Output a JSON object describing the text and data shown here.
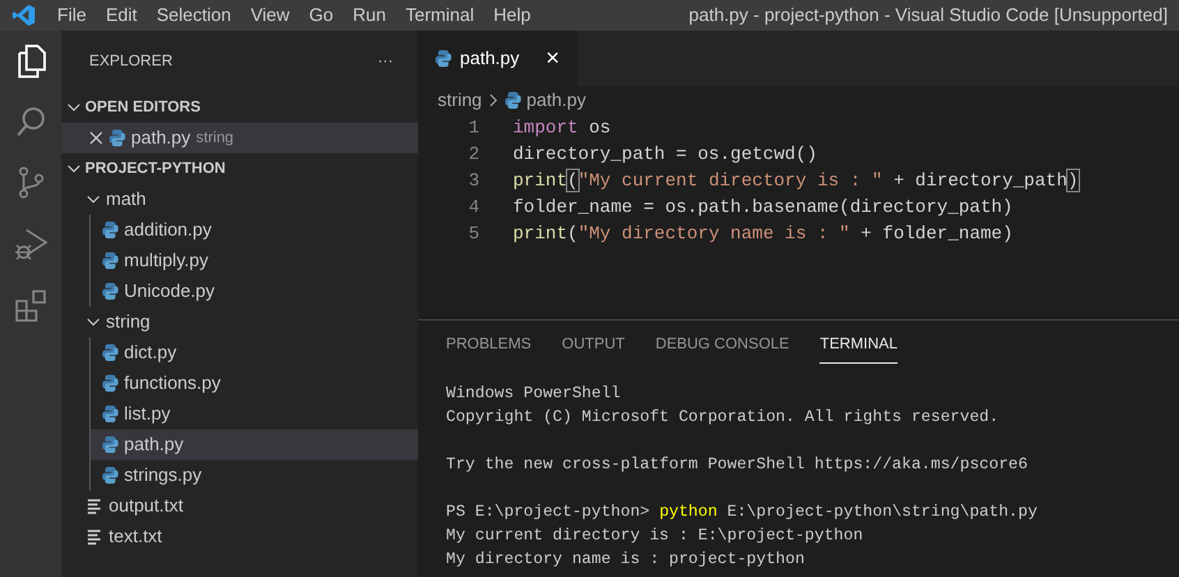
{
  "window": {
    "title": "path.py - project-python - Visual Studio Code [Unsupported]"
  },
  "menu": [
    "File",
    "Edit",
    "Selection",
    "View",
    "Go",
    "Run",
    "Terminal",
    "Help"
  ],
  "activity_bar": [
    {
      "kind": "files",
      "selected": true
    },
    {
      "kind": "search",
      "selected": false
    },
    {
      "kind": "source-control",
      "selected": false
    },
    {
      "kind": "run",
      "selected": false
    },
    {
      "kind": "extensions",
      "selected": false
    }
  ],
  "sidebar": {
    "title": "EXPLORER",
    "more": "···",
    "open_editors": {
      "label": "OPEN EDITORS",
      "expanded": true,
      "items": [
        {
          "name": "path.py",
          "folder": "string",
          "kind": "python",
          "selected": true
        }
      ]
    },
    "project": {
      "label": "PROJECT-PYTHON",
      "expanded": true,
      "children": [
        {
          "name": "math",
          "kind": "folder",
          "expanded": true,
          "selected": false,
          "children": [
            {
              "name": "addition.py",
              "kind": "python",
              "selected": false
            },
            {
              "name": "multiply.py",
              "kind": "python",
              "selected": false
            },
            {
              "name": "Unicode.py",
              "kind": "python",
              "selected": false
            }
          ]
        },
        {
          "name": "string",
          "kind": "folder",
          "expanded": true,
          "selected": false,
          "children": [
            {
              "name": "dict.py",
              "kind": "python",
              "selected": false
            },
            {
              "name": "functions.py",
              "kind": "python",
              "selected": false
            },
            {
              "name": "list.py",
              "kind": "python",
              "selected": false
            },
            {
              "name": "path.py",
              "kind": "python",
              "selected": true
            },
            {
              "name": "strings.py",
              "kind": "python",
              "selected": false
            }
          ]
        },
        {
          "name": "output.txt",
          "kind": "text",
          "selected": false
        },
        {
          "name": "text.txt",
          "kind": "text",
          "selected": false
        }
      ]
    }
  },
  "editor": {
    "tabs": [
      {
        "label": "path.py",
        "close": "×",
        "selected": true
      }
    ],
    "breadcrumb": [
      "string",
      "path.py"
    ],
    "lines": [
      {
        "number": "1",
        "tokens": [
          {
            "text": "import",
            "kind": "keyword"
          },
          {
            "text": " os",
            "kind": "plain"
          }
        ]
      },
      {
        "number": "2",
        "tokens": [
          {
            "text": "directory_path = os.getcwd()",
            "kind": "plain"
          }
        ]
      },
      {
        "number": "3",
        "tokens": [
          {
            "text": "print",
            "kind": "function"
          },
          {
            "text": "(",
            "kind": "bracket"
          },
          {
            "text": "\"My current directory is : \"",
            "kind": "string"
          },
          {
            "text": " + directory_path",
            "kind": "plain"
          },
          {
            "text": ")",
            "kind": "bracket"
          }
        ]
      },
      {
        "number": "4",
        "tokens": [
          {
            "text": "folder_name = os.path.basename(directory_path)",
            "kind": "plain"
          }
        ]
      },
      {
        "number": "5",
        "tokens": [
          {
            "text": "print",
            "kind": "function"
          },
          {
            "text": "(",
            "kind": "plain"
          },
          {
            "text": "\"My directory name is : \"",
            "kind": "string"
          },
          {
            "text": " + folder_name)",
            "kind": "plain"
          }
        ]
      }
    ]
  },
  "panel": {
    "tabs": [
      {
        "label": "PROBLEMS",
        "selected": false
      },
      {
        "label": "OUTPUT",
        "selected": false
      },
      {
        "label": "DEBUG CONSOLE",
        "selected": false
      },
      {
        "label": "TERMINAL",
        "selected": true
      }
    ],
    "terminal": [
      [
        [
          {
            "text": "Windows PowerShell",
            "kind": "text"
          }
        ],
        [
          {
            "text": "Copyright (C) Microsoft Corporation. All rights reserved.",
            "kind": "text"
          }
        ]
      ],
      [
        [
          {
            "text": "Try the new cross-platform PowerShell https://aka.ms/pscore6",
            "kind": "text"
          }
        ]
      ],
      [
        [
          {
            "text": "PS E:\\project-python> ",
            "kind": "text"
          },
          {
            "text": "python",
            "kind": "command"
          },
          {
            "text": " E:\\project-python\\string\\path.py",
            "kind": "text"
          }
        ],
        [
          {
            "text": "My current directory is : E:\\project-python",
            "kind": "text"
          }
        ],
        [
          {
            "text": "My directory name is : project-python",
            "kind": "text"
          }
        ]
      ]
    ]
  }
}
